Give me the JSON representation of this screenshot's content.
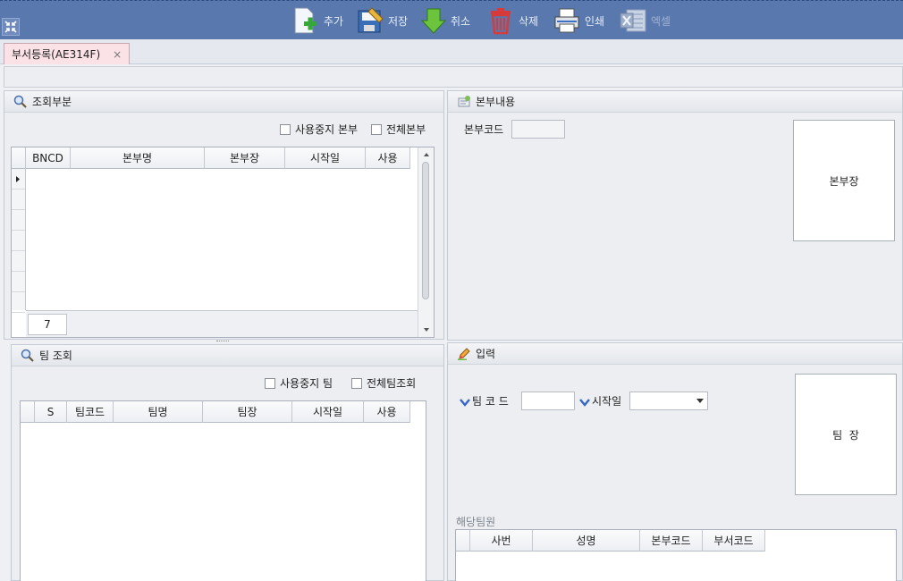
{
  "toolbar": {
    "buttons": [
      {
        "label": "추가",
        "icon": "add-document-icon"
      },
      {
        "label": "저장",
        "icon": "save-icon"
      },
      {
        "label": "취소",
        "icon": "cancel-arrow-icon"
      },
      {
        "label": "삭제",
        "icon": "trash-icon"
      },
      {
        "label": "인쇄",
        "icon": "printer-icon"
      },
      {
        "label": "엑셀",
        "icon": "excel-icon"
      }
    ]
  },
  "tab": {
    "label": "부서등록(AE314F)",
    "close": "×"
  },
  "left_top": {
    "title": "조회부분",
    "chk_inactive": "사용중지 본부",
    "chk_all": "전체본부",
    "columns": [
      "BNCD",
      "본부명",
      "본부장",
      "시작일",
      "사용"
    ],
    "count": "7"
  },
  "left_bottom": {
    "title": "팀 조회",
    "chk_inactive": "사용중지 팀",
    "chk_all": "전체팀조회",
    "columns": [
      "S",
      "팀코드",
      "팀명",
      "팀장",
      "시작일",
      "사용"
    ]
  },
  "right_top": {
    "title": "본부내용",
    "code_label": "본부코드",
    "photo_label": "본부장"
  },
  "right_bottom": {
    "title": "입력",
    "team_code_label": "팀 코 드",
    "start_label": "시작일",
    "photo_label": "팀  장",
    "members_title": "해당팀원",
    "columns": [
      "사번",
      "성명",
      "본부코드",
      "부서코드"
    ]
  }
}
